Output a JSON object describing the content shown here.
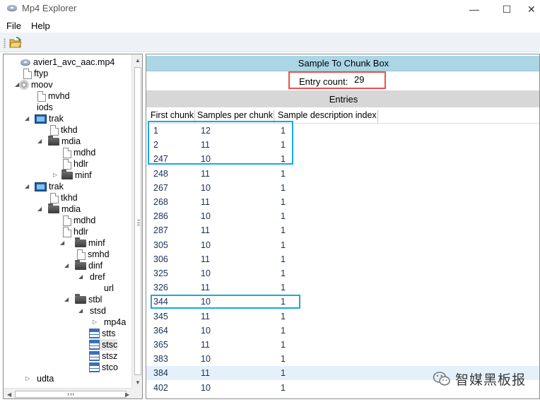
{
  "window": {
    "title": "Mp4 Explorer",
    "minimize_glyph": "—",
    "maximize_glyph": "☐",
    "close_glyph": "✕"
  },
  "menu": {
    "items": [
      "File",
      "Help"
    ]
  },
  "toolbar": {
    "open_icon": "open-folder-icon"
  },
  "tree": {
    "nodes": [
      {
        "label": "avier1_avc_aac.mp4",
        "icon": "file-icon",
        "expander": ""
      },
      {
        "label": "ftyp",
        "icon": "doc-icon",
        "expander": ""
      },
      {
        "label": "moov",
        "icon": "disc-icon",
        "expander": "◢"
      },
      {
        "label": "mvhd",
        "icon": "doc-icon",
        "expander": ""
      },
      {
        "label": "iods",
        "icon": "",
        "expander": ""
      },
      {
        "label": "trak",
        "icon": "monitor-icon",
        "expander": "◢"
      },
      {
        "label": "tkhd",
        "icon": "doc-icon",
        "expander": ""
      },
      {
        "label": "mdia",
        "icon": "folder-icon",
        "expander": "◢"
      },
      {
        "label": "mdhd",
        "icon": "doc-icon",
        "expander": ""
      },
      {
        "label": "hdlr",
        "icon": "doc-icon",
        "expander": ""
      },
      {
        "label": "minf",
        "icon": "folder-icon",
        "expander": "▷"
      },
      {
        "label": "trak",
        "icon": "monitor-icon",
        "expander": "◢"
      },
      {
        "label": "tkhd",
        "icon": "doc-icon",
        "expander": ""
      },
      {
        "label": "mdia",
        "icon": "folder-icon",
        "expander": "◢"
      },
      {
        "label": "mdhd",
        "icon": "doc-icon",
        "expander": ""
      },
      {
        "label": "hdlr",
        "icon": "doc-icon",
        "expander": ""
      },
      {
        "label": "minf",
        "icon": "folder-icon",
        "expander": "◢"
      },
      {
        "label": "smhd",
        "icon": "doc-icon",
        "expander": ""
      },
      {
        "label": "dinf",
        "icon": "folder-icon",
        "expander": "◢"
      },
      {
        "label": "dref",
        "icon": "",
        "expander": "◢"
      },
      {
        "label": "url",
        "icon": "",
        "expander": ""
      },
      {
        "label": "stbl",
        "icon": "folder-icon",
        "expander": "◢"
      },
      {
        "label": "stsd",
        "icon": "",
        "expander": "◢"
      },
      {
        "label": "mp4a",
        "icon": "",
        "expander": "▷"
      },
      {
        "label": "stts",
        "icon": "table-icon",
        "expander": ""
      },
      {
        "label": "stsc",
        "icon": "table-icon",
        "expander": "",
        "selected": true
      },
      {
        "label": "stsz",
        "icon": "table-icon",
        "expander": ""
      },
      {
        "label": "stco",
        "icon": "table-icon",
        "expander": ""
      },
      {
        "label": "udta",
        "icon": "",
        "expander": "▷"
      }
    ]
  },
  "box": {
    "title": "Sample To Chunk Box",
    "entry_count_label": "Entry count:",
    "entry_count_value": "29",
    "entries_title": "Entries",
    "columns": [
      "First chunk",
      "Samples per chunk",
      "Sample description index"
    ],
    "rows": [
      [
        "1",
        "12",
        "1"
      ],
      [
        "2",
        "11",
        "1"
      ],
      [
        "247",
        "10",
        "1"
      ],
      [
        "248",
        "11",
        "1"
      ],
      [
        "267",
        "10",
        "1"
      ],
      [
        "268",
        "11",
        "1"
      ],
      [
        "286",
        "10",
        "1"
      ],
      [
        "287",
        "11",
        "1"
      ],
      [
        "305",
        "10",
        "1"
      ],
      [
        "306",
        "11",
        "1"
      ],
      [
        "325",
        "10",
        "1"
      ],
      [
        "326",
        "11",
        "1"
      ],
      [
        "344",
        "10",
        "1"
      ],
      [
        "345",
        "11",
        "1"
      ],
      [
        "364",
        "10",
        "1"
      ],
      [
        "365",
        "11",
        "1"
      ],
      [
        "383",
        "10",
        "1"
      ],
      [
        "384",
        "11",
        "1"
      ],
      [
        "402",
        "10",
        "1"
      ]
    ],
    "highlighted_row": "384"
  },
  "watermark": {
    "text": "智媒黑板报",
    "icon": "wechat-icon"
  },
  "colors": {
    "box_header_bg": "#abd6e6",
    "entries_header_bg": "#d7d7d7",
    "annotation_red": "#e9534a",
    "annotation_blue": "#17a8e3",
    "row_highlight": "#e4f1fb"
  }
}
